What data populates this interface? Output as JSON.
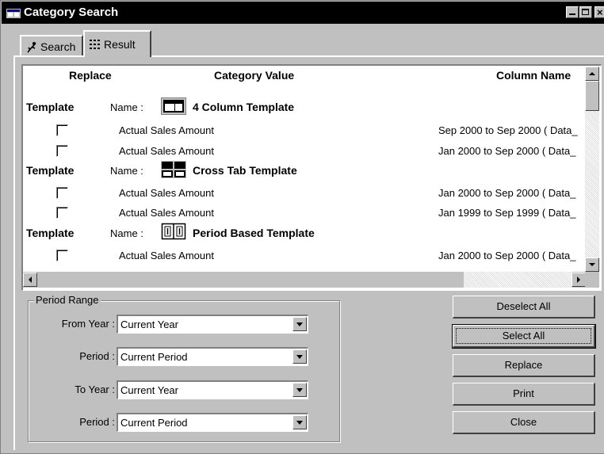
{
  "window": {
    "title": "Category Search"
  },
  "tabs": [
    {
      "label": "Search",
      "icon": "search-person-icon"
    },
    {
      "label": "Result",
      "icon": "grid-dots-icon"
    }
  ],
  "grid": {
    "headers": {
      "replace": "Replace",
      "category_value": "Category Value",
      "column_name": "Column Name"
    },
    "template_label": "Template",
    "name_label": "Name :",
    "groups": [
      {
        "title": "4 Column Template",
        "icon": "four-column-template-icon",
        "rows": [
          {
            "category": "Actual Sales Amount",
            "column": "Sep 2000 to Sep 2000 ( Data_"
          },
          {
            "category": "Actual Sales Amount",
            "column": "Jan 2000 to Sep 2000 ( Data_"
          }
        ]
      },
      {
        "title": "Cross Tab Template",
        "icon": "cross-tab-template-icon",
        "rows": [
          {
            "category": "Actual Sales Amount",
            "column": "Jan 2000 to Sep 2000 ( Data_"
          },
          {
            "category": "Actual Sales Amount",
            "column": "Jan 1999 to Sep 1999 ( Data_"
          }
        ]
      },
      {
        "title": "Period Based Template",
        "icon": "period-based-template-icon",
        "rows": [
          {
            "category": "Actual Sales Amount",
            "column": "Jan 2000 to Sep 2000 ( Data_"
          }
        ]
      }
    ]
  },
  "period_range": {
    "legend": "Period Range",
    "fields": [
      {
        "label": "From Year :",
        "value": "Current Year"
      },
      {
        "label": "Period :",
        "value": "Current Period"
      },
      {
        "label": "To Year :",
        "value": "Current Year"
      },
      {
        "label": "Period :",
        "value": "Current Period"
      }
    ]
  },
  "buttons": {
    "deselect_all": "Deselect All",
    "select_all": "Select All",
    "replace": "Replace",
    "print": "Print",
    "close": "Close"
  }
}
